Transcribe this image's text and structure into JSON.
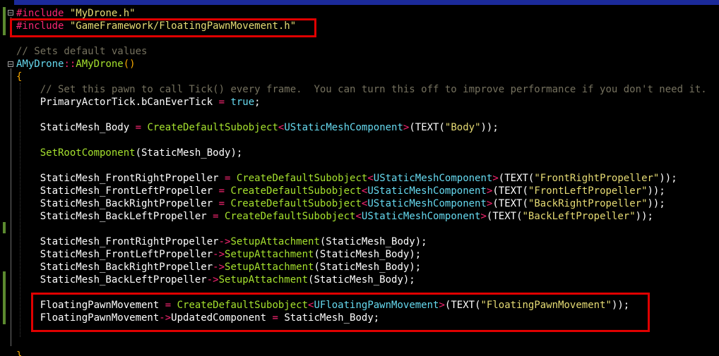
{
  "editor": {
    "colors": {
      "background": "#000000",
      "keyword": "#f92672",
      "string": "#e6db74",
      "comment": "#75715e",
      "type": "#66d9ef",
      "function": "#a6e22e",
      "highlight_box": "#e00000"
    },
    "lines": [
      [
        {
          "k": "kw",
          "t": "#include"
        },
        {
          "k": "tx",
          "t": " "
        },
        {
          "k": "str",
          "t": "\"MyDrone.h\""
        }
      ],
      [
        {
          "k": "kw",
          "t": "#include"
        },
        {
          "k": "tx",
          "t": " "
        },
        {
          "k": "str",
          "t": "\"GameFramework/FloatingPawnMovement.h\""
        }
      ],
      [],
      [
        {
          "k": "cm",
          "t": "// Sets default values"
        }
      ],
      [
        {
          "k": "cls",
          "t": "AMyDrone"
        },
        {
          "k": "op",
          "t": "::"
        },
        {
          "k": "fn",
          "t": "AMyDrone"
        },
        {
          "k": "brace",
          "t": "()"
        }
      ],
      [
        {
          "k": "brace",
          "t": "{"
        }
      ],
      [
        {
          "k": "tx",
          "t": "    "
        },
        {
          "k": "cm",
          "t": "// Set this pawn to call Tick() every frame.  You can turn this off to improve performance if you don't need it."
        }
      ],
      [
        {
          "k": "tx",
          "t": "    PrimaryActorTick.bCanEverTick "
        },
        {
          "k": "op",
          "t": "="
        },
        {
          "k": "tx",
          "t": " "
        },
        {
          "k": "kwb",
          "t": "true"
        },
        {
          "k": "tx",
          "t": ";"
        }
      ],
      [],
      [
        {
          "k": "tx",
          "t": "    StaticMesh_Body "
        },
        {
          "k": "op",
          "t": "="
        },
        {
          "k": "tx",
          "t": " "
        },
        {
          "k": "fn",
          "t": "CreateDefaultSubobject"
        },
        {
          "k": "op",
          "t": "<"
        },
        {
          "k": "type",
          "t": "UStaticMeshComponent"
        },
        {
          "k": "op",
          "t": ">"
        },
        {
          "k": "tx",
          "t": "(TEXT("
        },
        {
          "k": "str",
          "t": "\"Body\""
        },
        {
          "k": "tx",
          "t": "));"
        }
      ],
      [],
      [
        {
          "k": "tx",
          "t": "    "
        },
        {
          "k": "fn",
          "t": "SetRootComponent"
        },
        {
          "k": "tx",
          "t": "(StaticMesh_Body);"
        }
      ],
      [],
      [
        {
          "k": "tx",
          "t": "    StaticMesh_FrontRightPropeller "
        },
        {
          "k": "op",
          "t": "="
        },
        {
          "k": "tx",
          "t": " "
        },
        {
          "k": "fn",
          "t": "CreateDefaultSubobject"
        },
        {
          "k": "op",
          "t": "<"
        },
        {
          "k": "type",
          "t": "UStaticMeshComponent"
        },
        {
          "k": "op",
          "t": ">"
        },
        {
          "k": "tx",
          "t": "(TEXT("
        },
        {
          "k": "str",
          "t": "\"FrontRightPropeller\""
        },
        {
          "k": "tx",
          "t": "));"
        }
      ],
      [
        {
          "k": "tx",
          "t": "    StaticMesh_FrontLeftPropeller "
        },
        {
          "k": "op",
          "t": "="
        },
        {
          "k": "tx",
          "t": " "
        },
        {
          "k": "fn",
          "t": "CreateDefaultSubobject"
        },
        {
          "k": "op",
          "t": "<"
        },
        {
          "k": "type",
          "t": "UStaticMeshComponent"
        },
        {
          "k": "op",
          "t": ">"
        },
        {
          "k": "tx",
          "t": "(TEXT("
        },
        {
          "k": "str",
          "t": "\"FrontLeftPropeller\""
        },
        {
          "k": "tx",
          "t": "));"
        }
      ],
      [
        {
          "k": "tx",
          "t": "    StaticMesh_BackRightPropeller "
        },
        {
          "k": "op",
          "t": "="
        },
        {
          "k": "tx",
          "t": " "
        },
        {
          "k": "fn",
          "t": "CreateDefaultSubobject"
        },
        {
          "k": "op",
          "t": "<"
        },
        {
          "k": "type",
          "t": "UStaticMeshComponent"
        },
        {
          "k": "op",
          "t": ">"
        },
        {
          "k": "tx",
          "t": "(TEXT("
        },
        {
          "k": "str",
          "t": "\"BackRightPropeller\""
        },
        {
          "k": "tx",
          "t": "));"
        }
      ],
      [
        {
          "k": "tx",
          "t": "    StaticMesh_BackLeftPropeller "
        },
        {
          "k": "op",
          "t": "="
        },
        {
          "k": "tx",
          "t": " "
        },
        {
          "k": "fn",
          "t": "CreateDefaultSubobject"
        },
        {
          "k": "op",
          "t": "<"
        },
        {
          "k": "type",
          "t": "UStaticMeshComponent"
        },
        {
          "k": "op",
          "t": ">"
        },
        {
          "k": "tx",
          "t": "(TEXT("
        },
        {
          "k": "str",
          "t": "\"BackLeftPropeller\""
        },
        {
          "k": "tx",
          "t": "));"
        }
      ],
      [],
      [
        {
          "k": "tx",
          "t": "    StaticMesh_FrontRightPropeller"
        },
        {
          "k": "op",
          "t": "->"
        },
        {
          "k": "fn",
          "t": "SetupAttachment"
        },
        {
          "k": "tx",
          "t": "(StaticMesh_Body);"
        }
      ],
      [
        {
          "k": "tx",
          "t": "    StaticMesh_FrontLeftPropeller"
        },
        {
          "k": "op",
          "t": "->"
        },
        {
          "k": "fn",
          "t": "SetupAttachment"
        },
        {
          "k": "tx",
          "t": "(StaticMesh_Body);"
        }
      ],
      [
        {
          "k": "tx",
          "t": "    StaticMesh_BackRightPropeller"
        },
        {
          "k": "op",
          "t": "->"
        },
        {
          "k": "fn",
          "t": "SetupAttachment"
        },
        {
          "k": "tx",
          "t": "(StaticMesh_Body);"
        }
      ],
      [
        {
          "k": "tx",
          "t": "    StaticMesh_BackLeftPropeller"
        },
        {
          "k": "op",
          "t": "->"
        },
        {
          "k": "fn",
          "t": "SetupAttachment"
        },
        {
          "k": "tx",
          "t": "(StaticMesh_Body);"
        }
      ],
      [],
      [
        {
          "k": "tx",
          "t": "    FloatingPawnMovement "
        },
        {
          "k": "op",
          "t": "="
        },
        {
          "k": "tx",
          "t": " "
        },
        {
          "k": "fn",
          "t": "CreateDefaultSubobject"
        },
        {
          "k": "op",
          "t": "<"
        },
        {
          "k": "type",
          "t": "UFloatingPawnMovement"
        },
        {
          "k": "op",
          "t": ">"
        },
        {
          "k": "tx",
          "t": "(TEXT("
        },
        {
          "k": "str",
          "t": "\"FloatingPawnMovement\""
        },
        {
          "k": "tx",
          "t": "));"
        }
      ],
      [
        {
          "k": "tx",
          "t": "    FloatingPawnMovement"
        },
        {
          "k": "op",
          "t": "->"
        },
        {
          "k": "tx",
          "t": "UpdatedComponent "
        },
        {
          "k": "op",
          "t": "="
        },
        {
          "k": "tx",
          "t": " StaticMesh_Body;"
        }
      ],
      [],
      [],
      [
        {
          "k": "brace",
          "t": "}"
        }
      ]
    ],
    "fold_glyph": "−"
  }
}
